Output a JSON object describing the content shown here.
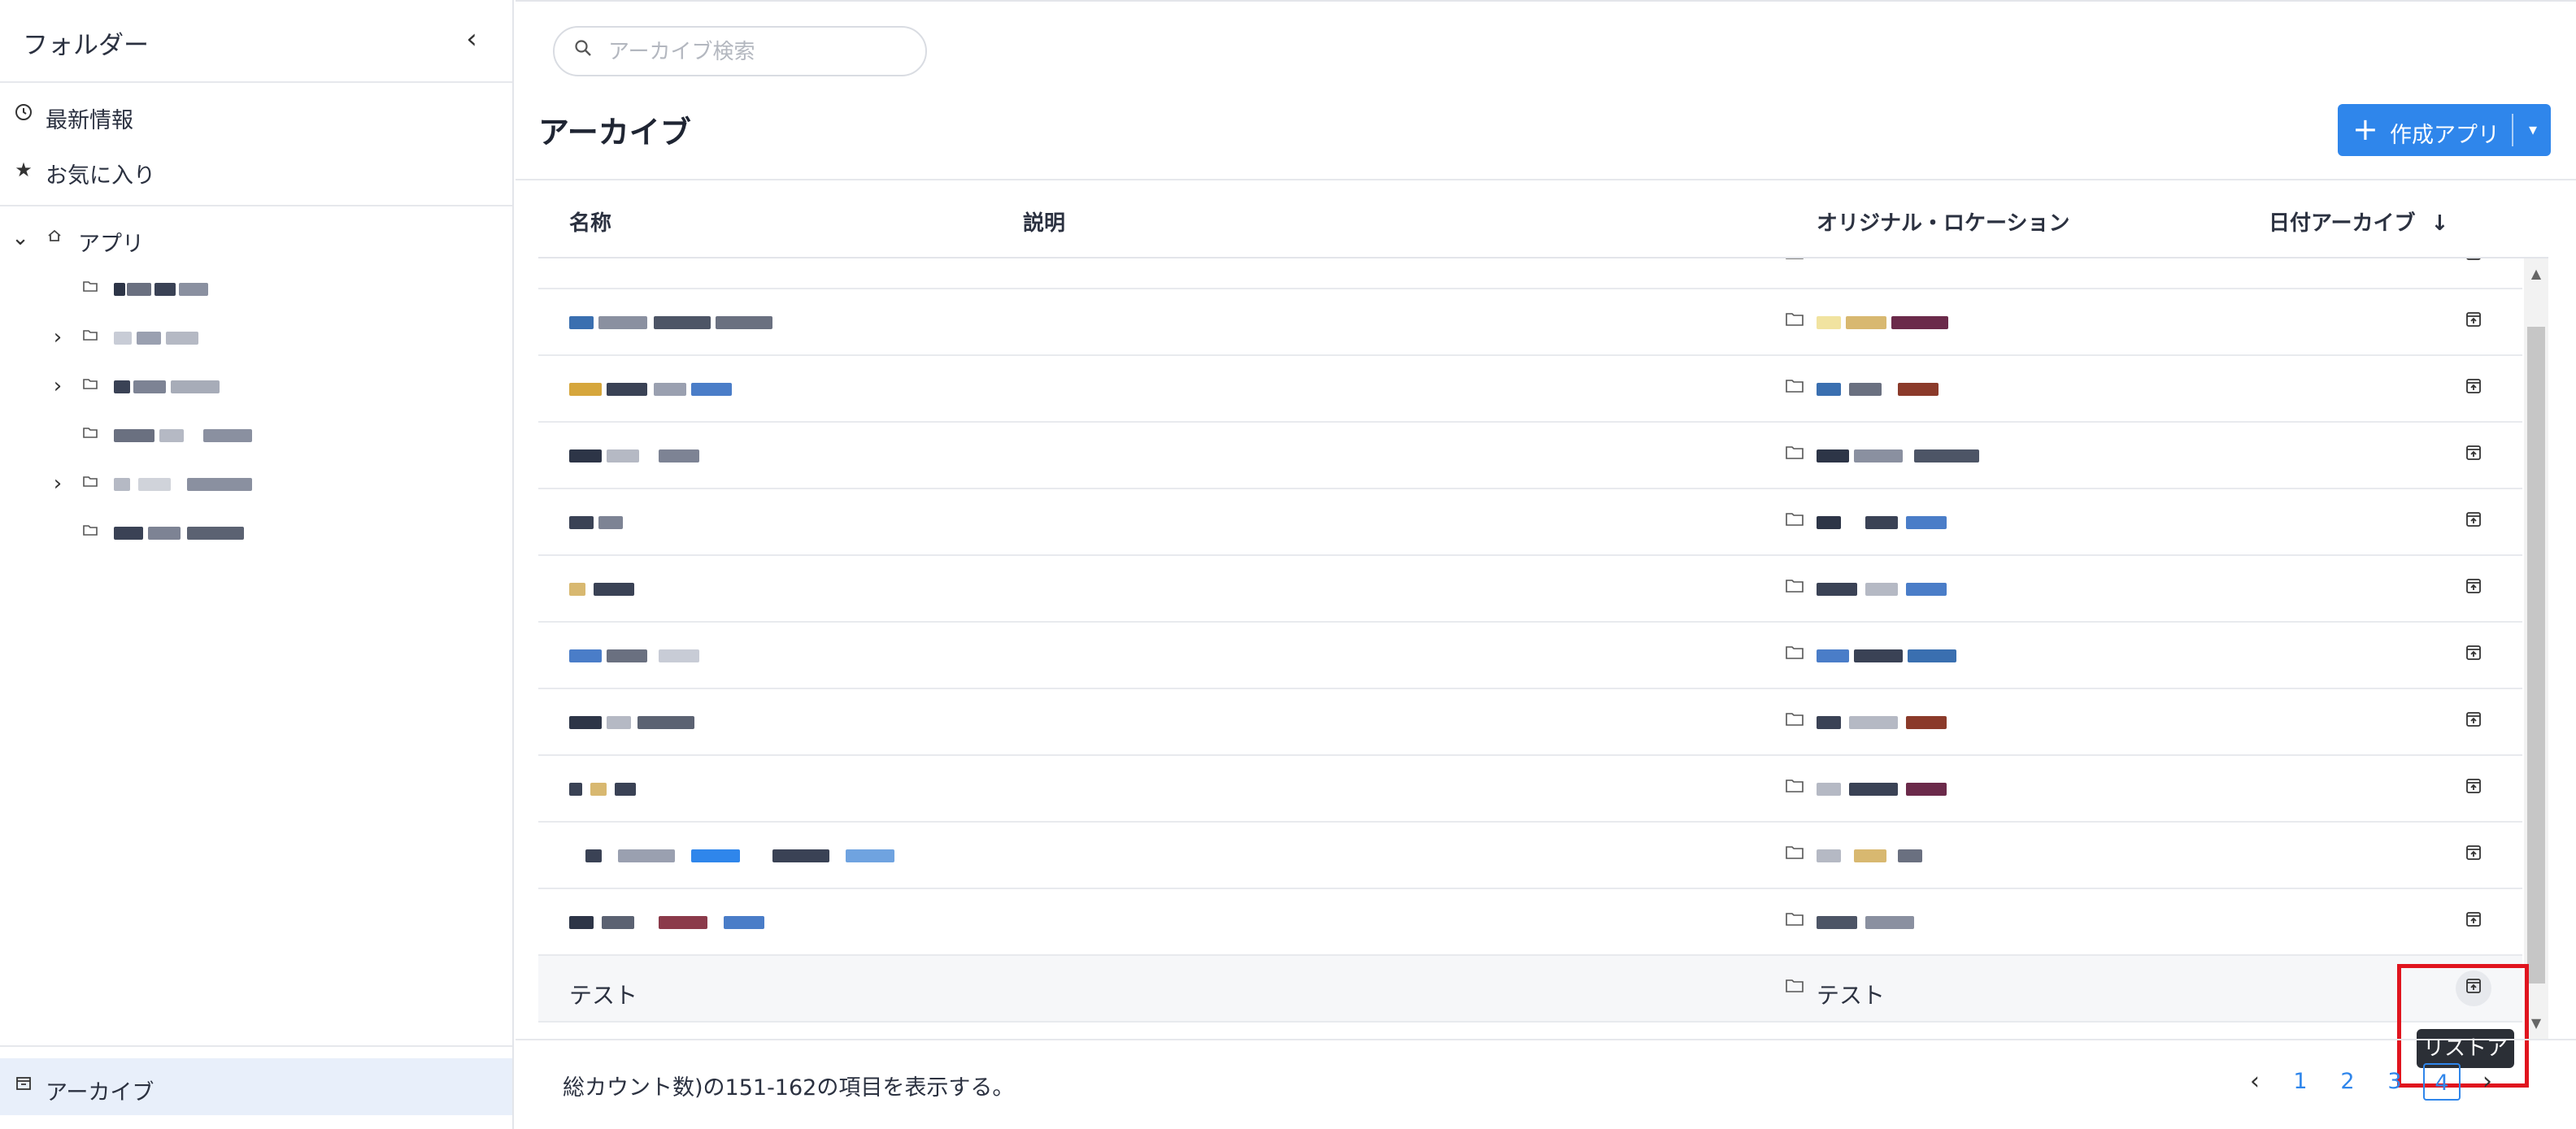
{
  "sidebar": {
    "title": "フォルダー",
    "collapse_icon": "chevron-left-icon",
    "recent": {
      "label": "最新情報",
      "icon": "clock-icon"
    },
    "favorites": {
      "label": "お気に入り",
      "icon": "star-icon"
    },
    "apps_root": {
      "label": "アプリ",
      "icon": "home-icon",
      "expanded": true
    },
    "tree_items": [
      {
        "label": "",
        "has_children": false
      },
      {
        "label": "",
        "has_children": true
      },
      {
        "label": "",
        "has_children": true
      },
      {
        "label": "",
        "has_children": false
      },
      {
        "label": "",
        "has_children": true
      },
      {
        "label": "",
        "has_children": false
      }
    ],
    "archive": {
      "label": "アーカイブ",
      "icon": "archive-icon",
      "selected": true
    }
  },
  "main": {
    "search": {
      "placeholder": "アーカイブ検索",
      "value": ""
    },
    "title": "アーカイブ",
    "create_button": {
      "label": "作成アプリ",
      "icon": "plus-icon"
    },
    "columns": {
      "name": "名称",
      "description": "説明",
      "location": "オリジナル・ロケーション",
      "date": "日付アーカイブ",
      "sort_icon": "arrow-down-icon"
    },
    "rows": [
      {
        "name": "",
        "location": "",
        "blurred": true
      },
      {
        "name": "",
        "location": "",
        "blurred": true
      },
      {
        "name": "",
        "location": "",
        "blurred": true
      },
      {
        "name": "",
        "location": "",
        "blurred": true
      },
      {
        "name": "",
        "location": "",
        "blurred": true
      },
      {
        "name": "",
        "location": "",
        "blurred": true
      },
      {
        "name": "",
        "location": "",
        "blurred": true
      },
      {
        "name": "",
        "location": "",
        "blurred": true
      },
      {
        "name": "",
        "location": "",
        "blurred": true
      },
      {
        "name": "",
        "location": "",
        "blurred": true
      },
      {
        "name": "",
        "location": "",
        "blurred": true
      },
      {
        "name": "テスト",
        "location": "テスト",
        "blurred": false,
        "hovered": true
      }
    ],
    "tooltip": "リストア",
    "footer_text": "総カウント数)の151-162の項目を表示する。",
    "pagination": {
      "prev_icon": "chevron-left-icon",
      "pages": [
        "1",
        "2",
        "3",
        "4"
      ],
      "current": "4",
      "next_icon": "chevron-right-icon"
    }
  },
  "colors": {
    "accent": "#2f86eb",
    "selected_bg": "#e8effa",
    "highlight": "#e0141e"
  }
}
